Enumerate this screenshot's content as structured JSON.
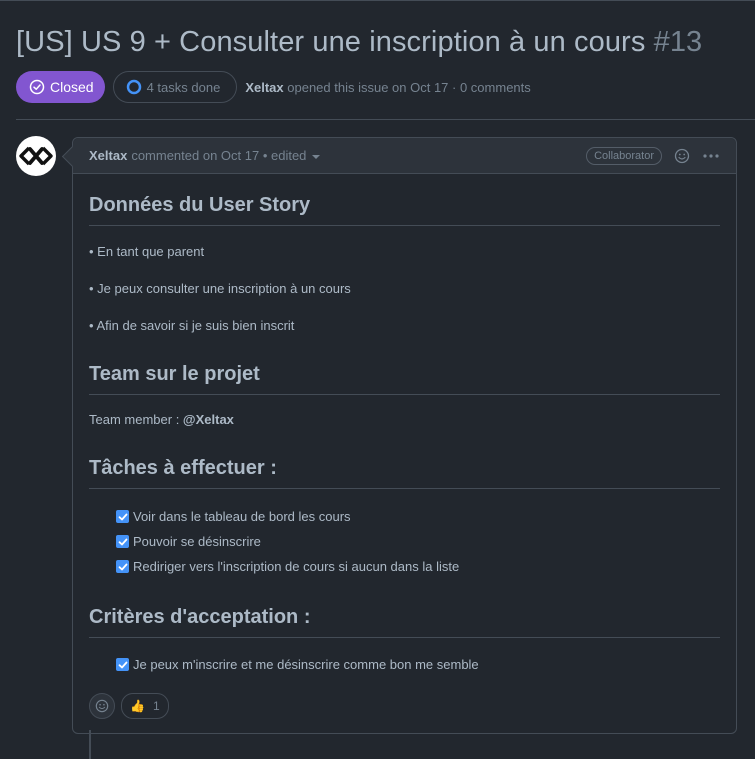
{
  "issue": {
    "title": "[US] US 9 + Consulter une inscription à un cours",
    "number": "#13",
    "state": "Closed",
    "tasks": "4 tasks done",
    "author": "Xeltax",
    "opened_text": "opened this issue on Oct 17 · 0 comments"
  },
  "comment": {
    "author": "Xeltax",
    "meta": "commented on Oct 17 • edited",
    "role": "Collaborator",
    "sections": {
      "user_story": {
        "heading": "Données du User Story",
        "lines": [
          "• En tant que parent",
          "• Je peux consulter une inscription à un cours",
          "• Afin de savoir si je suis bien inscrit"
        ]
      },
      "team": {
        "heading": "Team sur le projet",
        "label": "Team member : ",
        "member": "@Xeltax"
      },
      "tasks": {
        "heading": "Tâches à effectuer :",
        "items": [
          "Voir dans le tableau de bord les cours",
          "Pouvoir se désinscrire",
          "Rediriger vers l'inscription de cours si aucun dans la liste"
        ]
      },
      "criteria": {
        "heading": "Critères d'acceptation :",
        "items": [
          "Je peux m'inscrire et me désinscrire comme bon me semble"
        ]
      }
    },
    "reactions": {
      "emoji": "👍",
      "count": "1"
    }
  },
  "colors": {
    "background": "#22272e",
    "closed": "#8256d0",
    "checkbox": "#4493f8",
    "border": "#444c56"
  }
}
